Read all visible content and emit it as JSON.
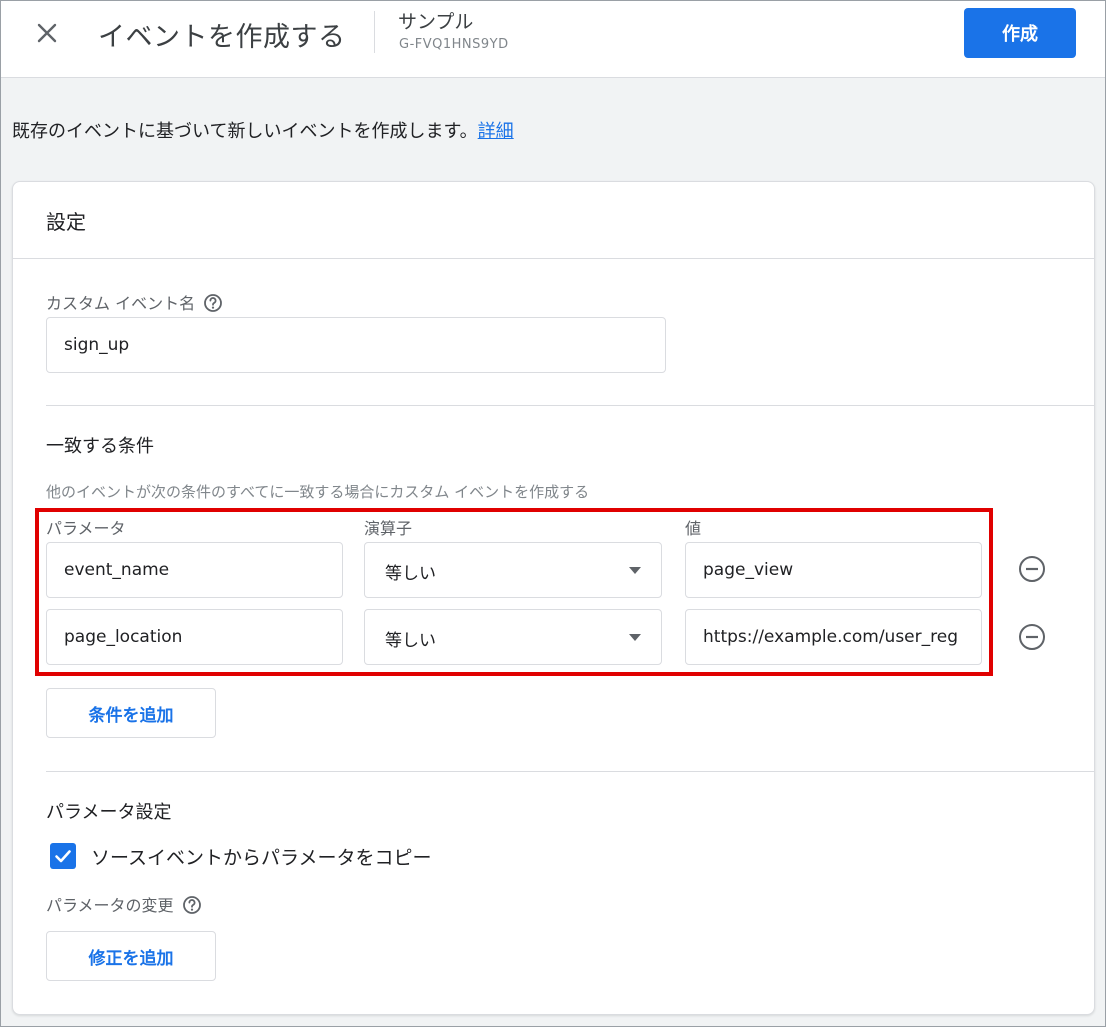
{
  "header": {
    "title": "イベントを作成する",
    "stream_name": "サンプル",
    "stream_id": "G-FVQ1HNS9YD",
    "create_label": "作成"
  },
  "description": {
    "text": "既存のイベントに基づいて新しいイベントを作成します。",
    "link_label": "詳細"
  },
  "card": {
    "title": "設定",
    "custom_event": {
      "label": "カスタム イベント名",
      "value": "sign_up"
    },
    "conditions": {
      "title": "一致する条件",
      "hint": "他のイベントが次の条件のすべてに一致する場合にカスタム イベントを作成する",
      "col_param": "パラメータ",
      "col_operator": "演算子",
      "col_value": "値",
      "rows": [
        {
          "param": "event_name",
          "operator": "等しい",
          "value": "page_view"
        },
        {
          "param": "page_location",
          "operator": "等しい",
          "value": "https://example.com/user_reg"
        }
      ],
      "add_label": "条件を追加"
    },
    "params": {
      "title": "パラメータ設定",
      "copy_label": "ソースイベントからパラメータをコピー",
      "copy_checked": true,
      "modify_label": "パラメータの変更",
      "add_mod_label": "修正を追加"
    }
  },
  "colors": {
    "accent": "#1a73e8",
    "highlight": "#e00000"
  }
}
